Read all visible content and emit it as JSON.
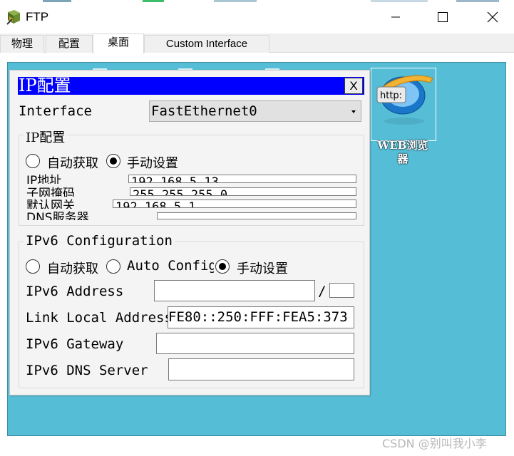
{
  "window": {
    "title": "FTP",
    "app_icon": "packet-tracer-device-icon",
    "controls": [
      "minimize",
      "maximize",
      "close"
    ]
  },
  "tabs": [
    {
      "label": "物理",
      "active": false
    },
    {
      "label": "配置",
      "active": false
    },
    {
      "label": "桌面",
      "active": true
    },
    {
      "label": "Custom Interface",
      "active": false
    }
  ],
  "desktop": {
    "background": "#55bdd6",
    "web_icon": {
      "badge": "http:",
      "label_line1": "WEB浏览",
      "label_line2": "器"
    }
  },
  "dialog": {
    "title": "IP配置",
    "title_bg": "#0000ff",
    "close_label": "X",
    "interface_label": "Interface",
    "interface_value": "FastEthernet0",
    "ipv4": {
      "legend": "IP配置",
      "dhcp_label": "自动获取",
      "static_label": "手动设置",
      "selected": "static",
      "ip_label": "IP地址",
      "ip_value": "192.168.5.13",
      "mask_label": "子网掩码",
      "mask_value": "255.255.255.0",
      "gateway_label": "默认网关",
      "gateway_value": "192.168.5.1",
      "dns_label": "DNS服务器",
      "dns_value": ""
    },
    "ipv6": {
      "legend": "IPv6 Configuration",
      "dhcp_label": "自动获取",
      "auto_label": "Auto Config",
      "static_label": "手动设置",
      "selected": "static",
      "address_label": "IPv6 Address",
      "address_value": "",
      "prefix_sep": "/",
      "prefix_value": "",
      "link_local_label": "Link Local Address",
      "link_local_value": "FE80::250:FFF:FEA5:373",
      "gateway_label": "IPv6 Gateway",
      "gateway_value": "",
      "dns_label": "IPv6 DNS Server",
      "dns_value": ""
    }
  },
  "watermark": "CSDN @别叫我小李"
}
